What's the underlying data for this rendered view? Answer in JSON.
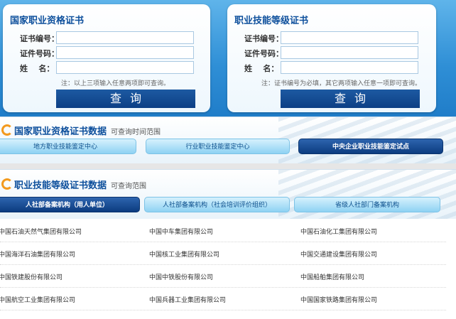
{
  "cert_qual": {
    "title": "国家职业资格证书",
    "labels": [
      "证书编号：",
      "证件号码：",
      "姓    名："
    ],
    "values": [
      "",
      "",
      ""
    ],
    "hint": "注：以上三项输入任意两项即可查询。",
    "button": "查询"
  },
  "cert_skill": {
    "title": "职业技能等级证书",
    "labels": [
      "证书编号：",
      "证件号码：",
      "姓    名："
    ],
    "values": [
      "",
      "",
      ""
    ],
    "hint": "注：证书编号为必填，其它两项输入任意一项即可查询。",
    "button": "查询"
  },
  "section_qual": {
    "title": "国家职业资格证书数据",
    "subtitle": "可查询时间范围",
    "tabs": [
      "地方职业技能鉴定中心",
      "行业职业技能鉴定中心",
      "中央企业职业技能鉴定试点"
    ]
  },
  "section_skill": {
    "title": "职业技能等级证书数据",
    "subtitle": "可查询范围",
    "tabs": [
      "人社部备案机构（用人单位）",
      "人社部备案机构（社会培训评价组织）",
      "省级人社部门备案机构"
    ]
  },
  "companies": [
    [
      "中国石油天然气集团有限公司",
      "中国中车集团有限公司",
      "中国石油化工集团有限公司"
    ],
    [
      "中国海洋石油集团有限公司",
      "中国核工业集团有限公司",
      "中国交通建设集团有限公司"
    ],
    [
      "中国铁建股份有限公司",
      "中国中铁股份有限公司",
      "中国船舶集团有限公司"
    ],
    [
      "中国航空工业集团有限公司",
      "中国兵器工业集团有限公司",
      "中国国家铁路集团有限公司"
    ]
  ]
}
